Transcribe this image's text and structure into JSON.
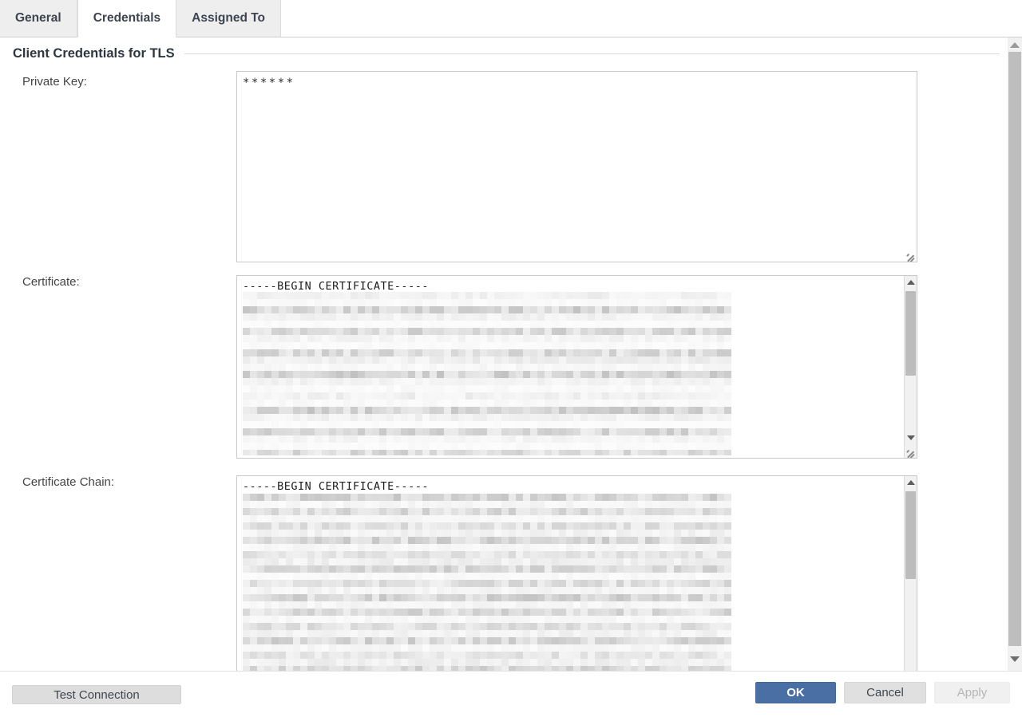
{
  "tabs": [
    {
      "id": "general",
      "label": "General",
      "active": false
    },
    {
      "id": "credentials",
      "label": "Credentials",
      "active": true
    },
    {
      "id": "assigned-to",
      "label": "Assigned To",
      "active": false
    }
  ],
  "section": {
    "title": "Client Credentials for TLS"
  },
  "fields": {
    "private_key": {
      "label": "Private Key:",
      "value": "******",
      "masked": true,
      "redacted": false
    },
    "certificate": {
      "label": "Certificate:",
      "value": "-----BEGIN CERTIFICATE-----",
      "redacted": true,
      "redaction_note": "certificate body pixelated"
    },
    "certificate_chain": {
      "label": "Certificate Chain:",
      "value": "-----BEGIN CERTIFICATE-----",
      "redacted": true,
      "redaction_note": "certificate chain body pixelated"
    }
  },
  "footer": {
    "test_connection_label": "Test Connection",
    "ok_label": "OK",
    "cancel_label": "Cancel",
    "apply_label": "Apply",
    "apply_enabled": false
  },
  "colors": {
    "accent": "#4a6fa5",
    "tab_inactive_bg": "#eeeeee",
    "tab_active_bg": "#ffffff",
    "border": "#c9c9c9",
    "scrollbar_thumb": "#bcbcbc",
    "disabled_text": "#b5b5b5"
  },
  "icons": {
    "scroll_up": "triangle-up-icon",
    "scroll_down": "triangle-down-icon",
    "resize_grip": "resize-grip-icon"
  }
}
